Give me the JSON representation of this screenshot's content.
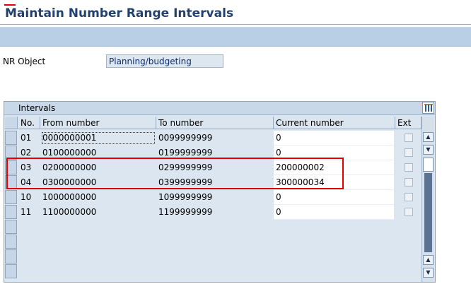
{
  "window": {
    "title": "Maintain Number Range Intervals"
  },
  "form": {
    "nr_object_label": "NR Object",
    "nr_object_value": "Planning/budgeting"
  },
  "intervals": {
    "title": "Intervals",
    "columns": [
      "No.",
      "From number",
      "To number",
      "Current number",
      "Ext"
    ],
    "rows": [
      {
        "no": "01",
        "from": "0000000001",
        "to": "0099999999",
        "current": "0"
      },
      {
        "no": "02",
        "from": "0100000000",
        "to": "0199999999",
        "current": "0"
      },
      {
        "no": "03",
        "from": "0200000000",
        "to": "0299999999",
        "current": "200000002"
      },
      {
        "no": "04",
        "from": "0300000000",
        "to": "0399999999",
        "current": "300000034"
      },
      {
        "no": "10",
        "from": "1000000000",
        "to": "1099999999",
        "current": "0"
      },
      {
        "no": "11",
        "from": "1100000000",
        "to": "1199999999",
        "current": "0"
      }
    ]
  },
  "colors": {
    "highlight": "#e00000",
    "title": "#22416f"
  },
  "icons": {
    "column_config": "table-settings-icon",
    "scroll_up": "arrow-up-icon",
    "scroll_down": "arrow-down-icon"
  }
}
